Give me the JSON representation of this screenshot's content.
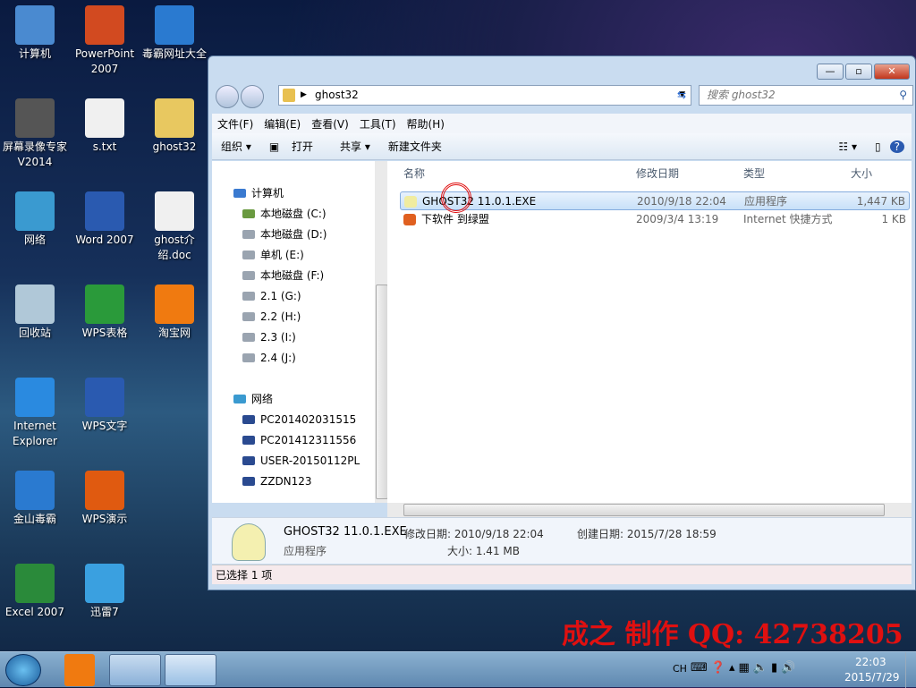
{
  "desktop_icons": [
    {
      "label": "计算机",
      "color": "#4a8ad0"
    },
    {
      "label": "PowerPoint 2007",
      "color": "#d24a20"
    },
    {
      "label": "毒霸网址大全",
      "color": "#2a7ad0"
    },
    {
      "label": "屏幕录像专家 V2014",
      "color": "#555"
    },
    {
      "label": "s.txt",
      "color": "#f0f0f0"
    },
    {
      "label": "ghost32",
      "color": "#e8c860"
    },
    {
      "label": "网络",
      "color": "#3a9ad0"
    },
    {
      "label": "Word 2007",
      "color": "#2a5ab0"
    },
    {
      "label": "ghost介绍.doc",
      "color": "#f0f0f0"
    },
    {
      "label": "回收站",
      "color": "#b0c8d8"
    },
    {
      "label": "WPS表格",
      "color": "#2a9a3a"
    },
    {
      "label": "淘宝网",
      "color": "#f07a10"
    },
    {
      "label": "Internet Explorer",
      "color": "#2a8ae0"
    },
    {
      "label": "WPS文字",
      "color": "#2a5ab0"
    },
    {
      "label": "金山毒霸",
      "color": "#2a7ad0"
    },
    {
      "label": "WPS演示",
      "color": "#e05a10"
    },
    {
      "label": "Excel 2007",
      "color": "#2a8a3a"
    },
    {
      "label": "迅雷7",
      "color": "#3aa0e0"
    }
  ],
  "window": {
    "address": "ghost32",
    "search_placeholder": "搜索 ghost32",
    "menu": [
      "文件(F)",
      "编辑(E)",
      "查看(V)",
      "工具(T)",
      "帮助(H)"
    ],
    "toolbar": {
      "organize": "组织 ▾",
      "open": "打开",
      "share": "共享 ▾",
      "new_folder": "新建文件夹"
    },
    "nav": {
      "computer": "计算机",
      "drives": [
        "本地磁盘 (C:)",
        "本地磁盘 (D:)",
        "单机 (E:)",
        "本地磁盘 (F:)",
        "2.1 (G:)",
        "2.2 (H:)",
        "2.3 (I:)",
        "2.4 (J:)"
      ],
      "network": "网络",
      "hosts": [
        "PC201402031515",
        "PC201412311556",
        "USER-20150112PL",
        "ZZDN123"
      ]
    },
    "columns": [
      "名称",
      "修改日期",
      "类型",
      "大小"
    ],
    "files": [
      {
        "name": "GHOST32 11.0.1.EXE",
        "date": "2010/9/18 22:04",
        "type": "应用程序",
        "size": "1,447 KB",
        "selected": true
      },
      {
        "name": "下软件 到绿盟",
        "date": "2009/3/4 13:19",
        "type": "Internet 快捷方式",
        "size": "1 KB"
      }
    ],
    "details": {
      "name": "GHOST32 11.0.1.EXE",
      "kind": "应用程序",
      "modified": "修改日期: 2010/9/18 22:04",
      "size": "大小: 1.41 MB",
      "created": "创建日期: 2015/7/28 18:59"
    },
    "status": "已选择 1 项"
  },
  "watermark": "成之 制作  QQ: 42738205",
  "tray": {
    "lang": "CH",
    "time": "22:03",
    "date": "2015/7/29"
  }
}
